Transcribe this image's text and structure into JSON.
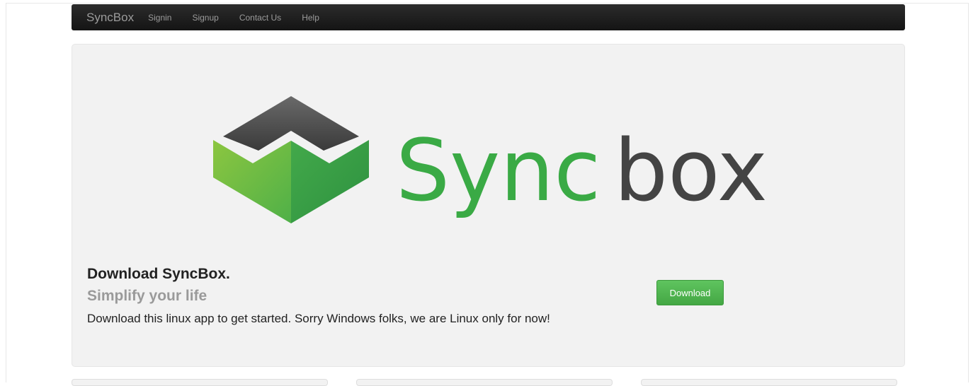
{
  "navbar": {
    "brand": "SyncBox",
    "links": [
      "Signin",
      "Signup",
      "Contact Us",
      "Help"
    ]
  },
  "hero": {
    "logo": {
      "text_green": "Sync",
      "text_dark": "box",
      "green_color": "#3aaa45",
      "dark_color": "#444444"
    },
    "title": "Download SyncBox.",
    "subtitle": "Simplify your life",
    "text": "Download this linux app to get started. Sorry Windows folks, we are Linux only for now!",
    "download_label": "Download"
  },
  "colors": {
    "navbar_bg": "#1b1b1b",
    "hero_bg": "#f2f2f2",
    "button_green": "#51b351"
  }
}
